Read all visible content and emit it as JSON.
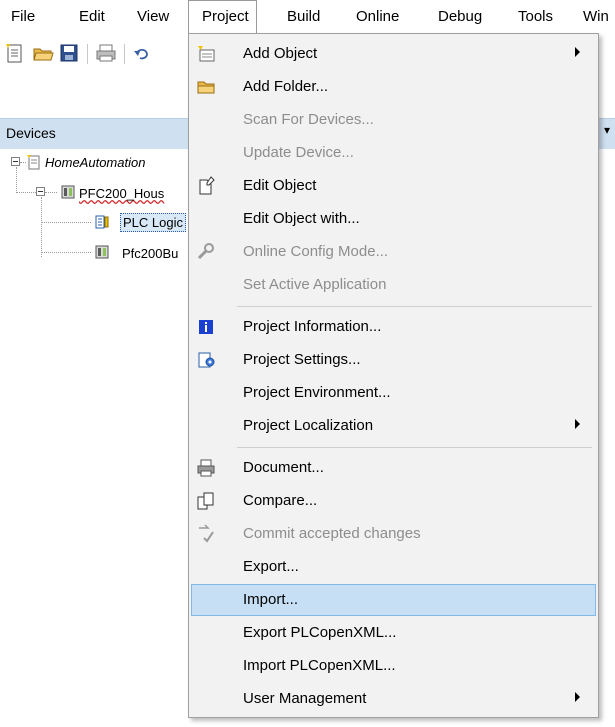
{
  "menubar": {
    "items": [
      "File",
      "Edit",
      "View",
      "Project",
      "Build",
      "Online",
      "Debug",
      "Tools",
      "Win"
    ]
  },
  "devices": {
    "title": "Devices",
    "tree": [
      "HomeAutomation",
      "PFC200_Hous",
      "PLC Logic",
      "Pfc200Bu"
    ]
  },
  "dropdown": {
    "items": [
      {
        "label": "Add Object",
        "icon": "add-object-icon",
        "submenu": true
      },
      {
        "label": "Add Folder...",
        "icon": "folder-icon"
      },
      {
        "label": "Scan For Devices...",
        "disabled": true
      },
      {
        "label": "Update Device...",
        "disabled": true
      },
      {
        "label": "Edit Object",
        "icon": "edit-object-icon"
      },
      {
        "label": "Edit Object with..."
      },
      {
        "label": "Online Config Mode...",
        "icon": "wrench-icon",
        "disabled": true
      },
      {
        "label": "Set Active Application",
        "disabled": true
      },
      {
        "label": "Project Information...",
        "icon": "info-icon"
      },
      {
        "label": "Project Settings...",
        "icon": "settings-icon"
      },
      {
        "label": "Project Environment..."
      },
      {
        "label": "Project Localization",
        "submenu": true
      },
      {
        "label": "Document...",
        "icon": "printer-icon"
      },
      {
        "label": "Compare...",
        "icon": "compare-icon"
      },
      {
        "label": "Commit accepted changes",
        "icon": "commit-icon",
        "disabled": true
      },
      {
        "label": "Export..."
      },
      {
        "label": "Import...",
        "highlighted": true
      },
      {
        "label": "Export PLCopenXML..."
      },
      {
        "label": "Import PLCopenXML..."
      },
      {
        "label": "User Management",
        "submenu": true
      }
    ]
  },
  "colors": {
    "menu_bg": "#f2f2f2",
    "highlight_bg": "#c7dff4",
    "highlight_border": "#86b8e6",
    "panel_header": "#cfe0f1",
    "disabled_text": "#8d8d8d"
  }
}
